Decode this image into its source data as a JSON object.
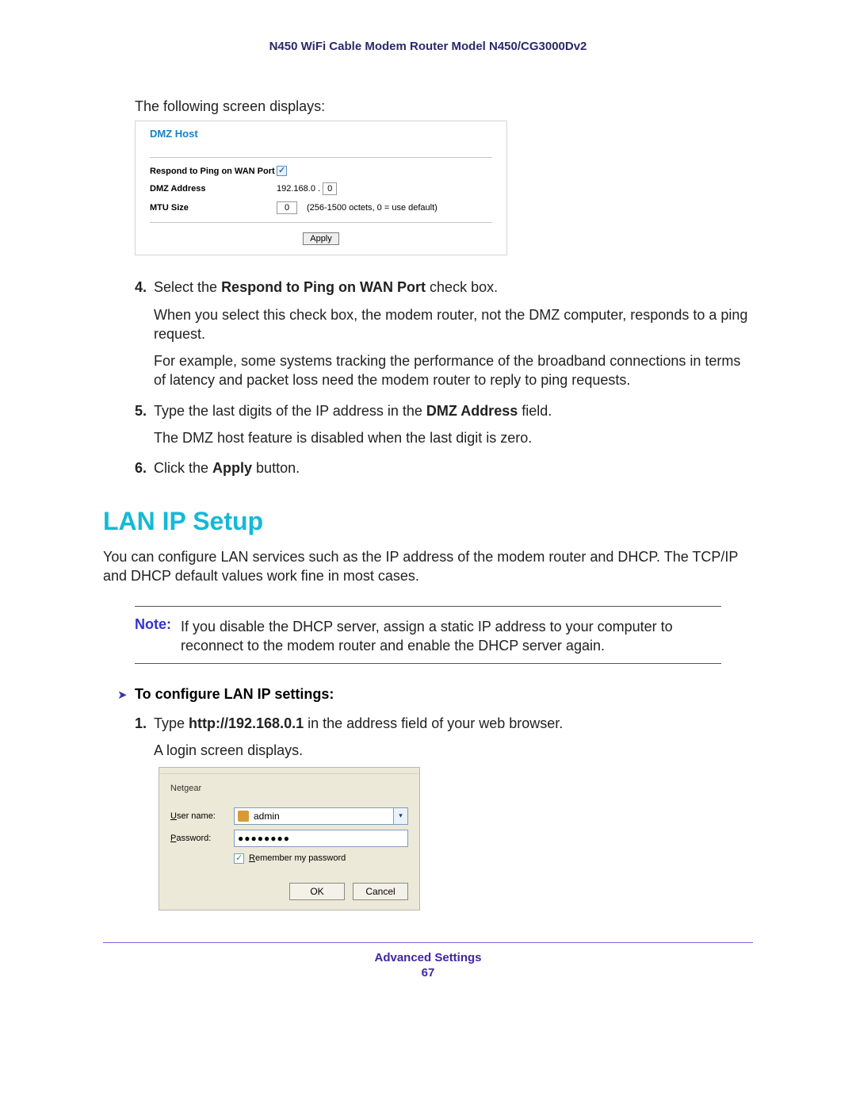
{
  "header": {
    "title": "N450 WiFi Cable Modem Router Model N450/CG3000Dv2"
  },
  "intro_text": "The following screen displays:",
  "dmz": {
    "title": "DMZ Host",
    "respond_label": "Respond to Ping on WAN Port",
    "dmz_addr_label": "DMZ Address",
    "dmz_addr_prefix": "192.168.0 .",
    "dmz_addr_last": "0",
    "mtu_label": "MTU Size",
    "mtu_value": "0",
    "mtu_note": "(256-1500 octets, 0 = use default)",
    "apply_label": "Apply"
  },
  "steps": {
    "s4": {
      "num": "4.",
      "line1a": "Select the ",
      "line1b_bold": "Respond to Ping on WAN Port",
      "line1c": " check box.",
      "p2": "When you select this check box, the modem router, not the DMZ computer, responds to a ping request.",
      "p3": "For example, some systems tracking the performance of the broadband connections in terms of latency and packet loss need the modem router to reply to ping requests."
    },
    "s5": {
      "num": "5.",
      "line1a": "Type the last digits of the IP address in the ",
      "line1b_bold": "DMZ Address",
      "line1c": " field.",
      "p2": "The DMZ host feature is disabled when the last digit is zero."
    },
    "s6": {
      "num": "6.",
      "line1a": "Click the ",
      "line1b_bold": "Apply",
      "line1c": " button."
    }
  },
  "lan": {
    "heading": "LAN IP Setup",
    "intro": "You can configure LAN services such as the IP address of the modem router and DHCP. The TCP/IP and DHCP default values work fine in most cases."
  },
  "note": {
    "label": "Note:",
    "body": "If you disable the DHCP server, assign a static IP address to your computer to reconnect to the modem router and enable the DHCP server again."
  },
  "proc": {
    "title": "To configure LAN IP settings:",
    "s1": {
      "num": "1.",
      "a": "Type ",
      "b_bold": "http://192.168.0.1",
      "c": " in the address field of your web browser.",
      "p2": "A login screen displays."
    }
  },
  "login": {
    "site": "Netgear",
    "user_label_u": "U",
    "user_label_rest": "ser name:",
    "user_value": "admin",
    "pw_label_u": "P",
    "pw_label_rest": "assword:",
    "pw_value": "●●●●●●●●",
    "remember_u": "R",
    "remember_rest": "emember my password",
    "ok": "OK",
    "cancel": "Cancel"
  },
  "footer": {
    "section": "Advanced Settings",
    "page": "67"
  }
}
